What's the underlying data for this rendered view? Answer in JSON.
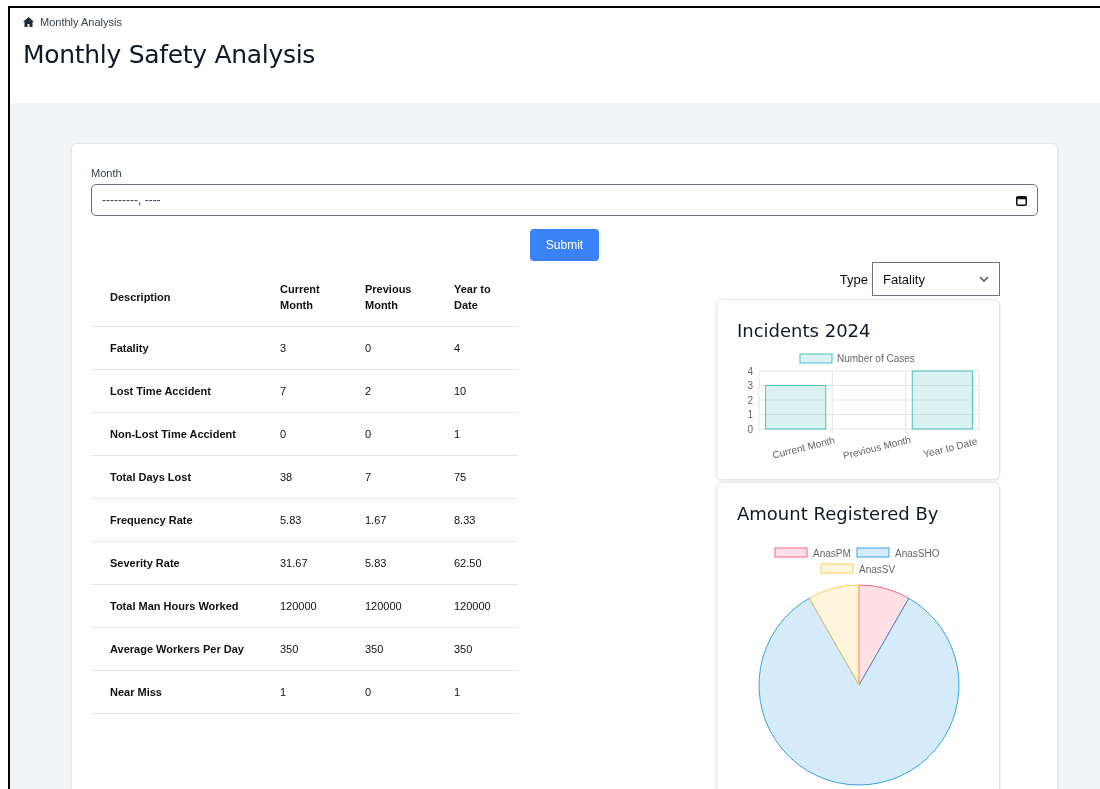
{
  "breadcrumb": {
    "label": "Monthly Analysis"
  },
  "page_title": "Monthly Safety Analysis",
  "month_field": {
    "label": "Month",
    "placeholder": "---------, ----"
  },
  "submit_button": "Submit",
  "table": {
    "columns": [
      "Description",
      "Current Month",
      "Previous Month",
      "Year to Date"
    ],
    "rows": [
      [
        "Fatality",
        "3",
        "0",
        "4"
      ],
      [
        "Lost Time Accident",
        "7",
        "2",
        "10"
      ],
      [
        "Non-Lost Time Accident",
        "0",
        "0",
        "1"
      ],
      [
        "Total Days Lost",
        "38",
        "7",
        "75"
      ],
      [
        "Frequency Rate",
        "5.83",
        "1.67",
        "8.33"
      ],
      [
        "Severity Rate",
        "31.67",
        "5.83",
        "62.50"
      ],
      [
        "Total Man Hours Worked",
        "120000",
        "120000",
        "120000"
      ],
      [
        "Average Workers Per Day",
        "350",
        "350",
        "350"
      ],
      [
        "Near Miss",
        "1",
        "0",
        "1"
      ]
    ]
  },
  "type_select": {
    "label": "Type",
    "value": "Fatality"
  },
  "incidents_card": {
    "title": "Incidents 2024",
    "chart_data": {
      "type": "bar",
      "categories": [
        "Current Month",
        "Previous Month",
        "Year to Date"
      ],
      "series": [
        {
          "name": "Number of Cases",
          "color": "#4bc0c0",
          "values": [
            3,
            0,
            4
          ]
        }
      ],
      "ylim": [
        0,
        4
      ],
      "yticks": [
        0,
        1,
        2,
        3,
        4
      ],
      "grid": true,
      "legend": "top"
    }
  },
  "registered_card": {
    "title": "Amount Registered By",
    "chart_data": {
      "type": "pie",
      "categories": [
        "AnasPM",
        "AnasSHO",
        "AnasSV"
      ],
      "values": [
        8.3,
        83.4,
        8.3
      ],
      "colors": [
        "#ff6384",
        "#36a2eb",
        "#ffcd56"
      ],
      "legend": "top"
    }
  }
}
